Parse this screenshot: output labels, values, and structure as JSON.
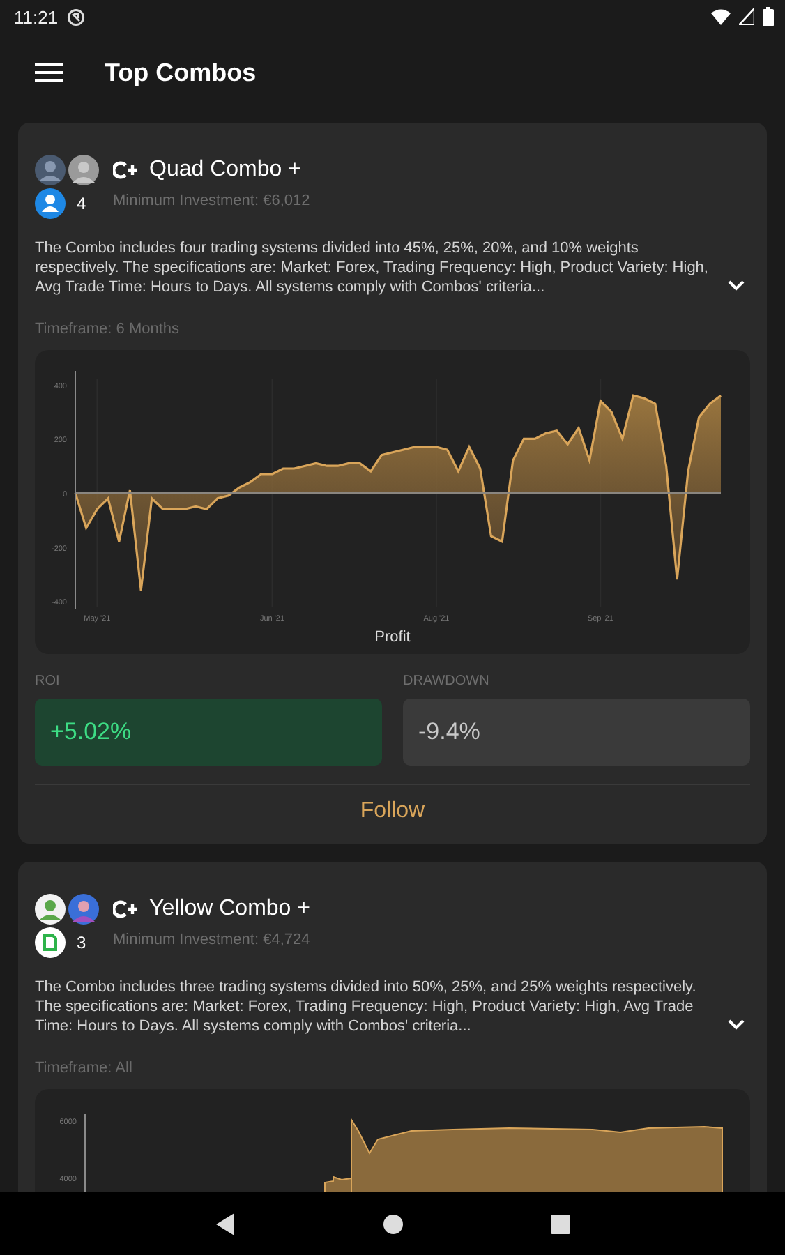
{
  "status_bar": {
    "time": "11:21"
  },
  "app_bar": {
    "title": "Top Combos"
  },
  "combos": [
    {
      "name": "Quad Combo +",
      "participants": "4",
      "min_investment": "Minimum Investment: €6,012",
      "description": "The Combo includes four trading systems divided into 45%, 25%, 20%, and 10% weights respectively. The specifications are: Market: Forex, Trading Frequency: High, Product Variety: High, Avg Trade Time: Hours to Days. All systems comply with Combos' criteria...",
      "timeframe": "Timeframe: 6 Months",
      "chart_data": {
        "type": "area",
        "xlabel": "Profit",
        "categories": [
          null,
          null,
          "May '21",
          null,
          null,
          null,
          null,
          null,
          null,
          null,
          null,
          null,
          null,
          null,
          null,
          null,
          null,
          null,
          "Jun '21",
          null,
          null,
          null,
          null,
          null,
          null,
          null,
          null,
          null,
          null,
          null,
          null,
          null,
          null,
          "Aug '21",
          null,
          null,
          null,
          null,
          null,
          null,
          null,
          null,
          null,
          null,
          null,
          null,
          null,
          null,
          "Sep '21",
          null,
          null,
          null,
          null,
          null,
          null,
          null,
          null,
          null,
          null,
          null
        ],
        "series": [
          {
            "color": "#d9a55a",
            "values": [
              0,
              -130,
              -60,
              -20,
              -180,
              10,
              -360,
              -20,
              -60,
              -60,
              -60,
              -50,
              -60,
              -20,
              -10,
              20,
              40,
              70,
              70,
              90,
              90,
              100,
              110,
              100,
              100,
              110,
              110,
              80,
              140,
              150,
              160,
              170,
              170,
              170,
              160,
              80,
              170,
              90,
              -160,
              -180,
              120,
              200,
              200,
              220,
              230,
              180,
              240,
              120,
              340,
              300,
              200,
              360,
              350,
              330,
              100,
              -320,
              80,
              280,
              330,
              360
            ]
          }
        ],
        "ylim": [
          -420,
          420
        ],
        "yticks": [
          -400,
          -200,
          0,
          200,
          400
        ],
        "grid": true
      },
      "roi": {
        "label": "ROI",
        "value": "+5.02%"
      },
      "drawdown": {
        "label": "DRAWDOWN",
        "value": "-9.4%"
      },
      "follow": "Follow"
    },
    {
      "name": "Yellow Combo +",
      "participants": "3",
      "min_investment": "Minimum Investment: €4,724",
      "description": "The Combo includes three trading systems divided into 50%, 25%, and 25% weights respectively. The specifications are: Market: Forex, Trading Frequency: High, Product Variety: High, Avg Trade Time: Hours to Days. All systems comply with Combos' criteria...",
      "timeframe": "Timeframe: All",
      "chart_axis_labels": [
        "6000",
        "4000"
      ]
    }
  ]
}
